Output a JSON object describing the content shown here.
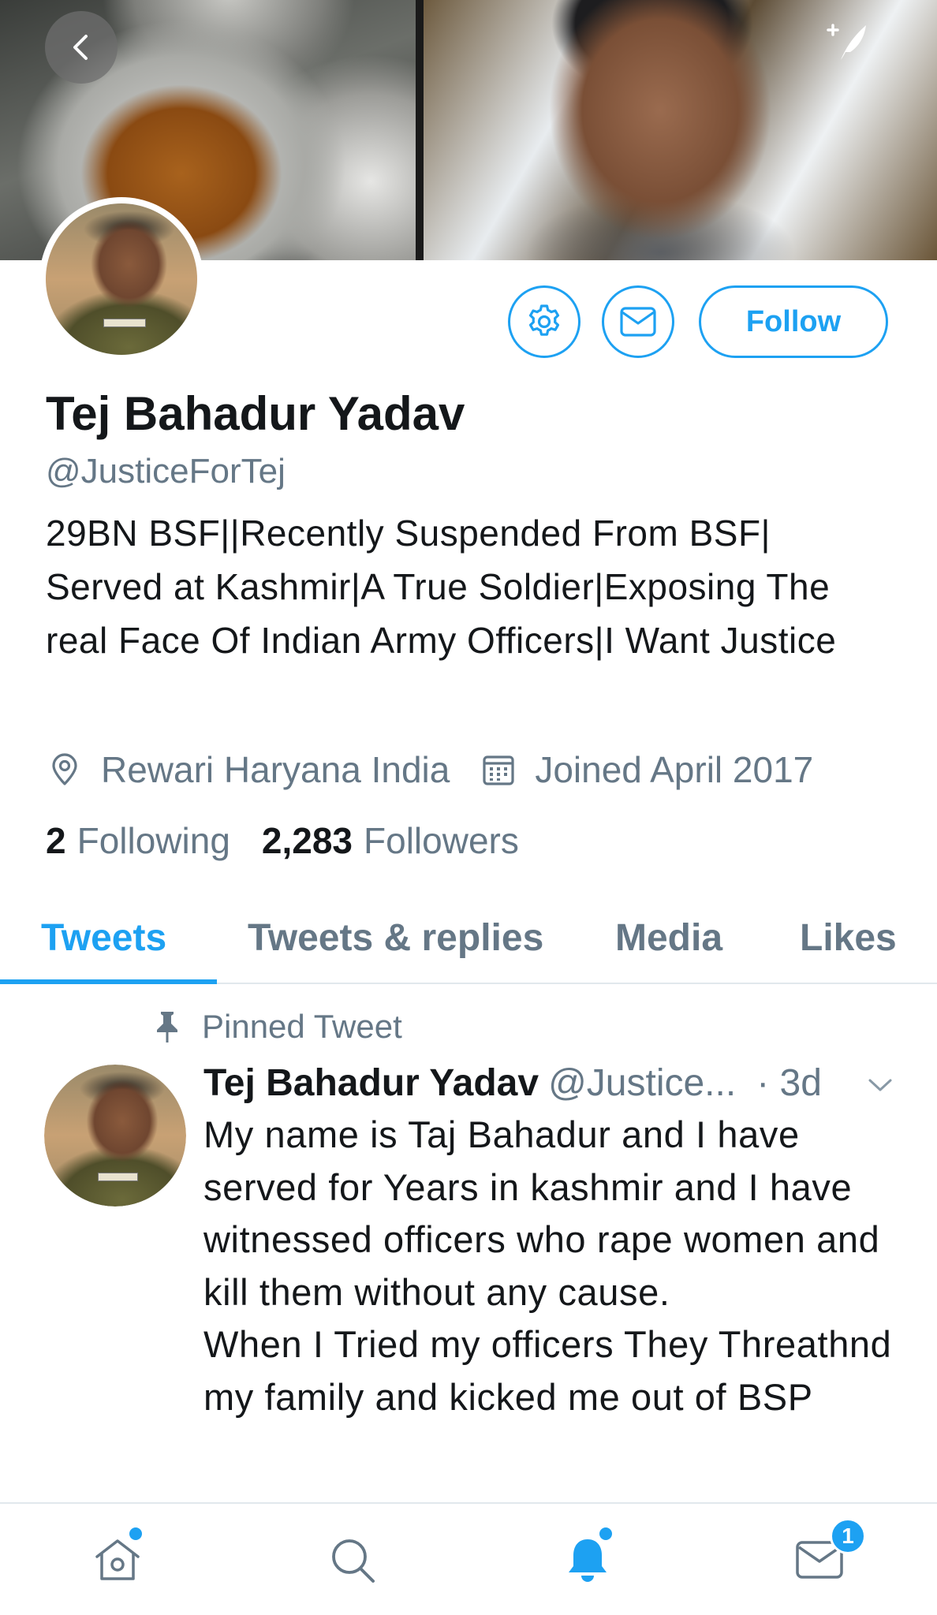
{
  "header": {
    "back_icon": "chevron-left-icon",
    "compose_icon": "compose-tweet-icon"
  },
  "profile": {
    "name": "Tej Bahadur Yadav",
    "handle": "@JusticeForTej",
    "bio": "29BN BSF||Recently Suspended From BSF| Served at Kashmir|A True Soldier|Exposing The real Face Of Indian Army Officers|I Want Justice",
    "location": "Rewari Haryana India",
    "joined": "Joined April 2017",
    "following_count": "2",
    "following_label": "Following",
    "followers_count": "2,283",
    "followers_label": "Followers",
    "avatar_tag_text": "TEJ BAHADUR YADAV"
  },
  "actions": {
    "settings_icon": "gear-icon",
    "message_icon": "envelope-icon",
    "follow_label": "Follow"
  },
  "tabs": [
    {
      "label": "Tweets",
      "active": true
    },
    {
      "label": "Tweets & replies",
      "active": false
    },
    {
      "label": "Media",
      "active": false
    },
    {
      "label": "Likes",
      "active": false
    }
  ],
  "pinned_tweet": {
    "pinned_label": "Pinned Tweet",
    "author_name": "Tej Bahadur Yadav",
    "author_handle": "@Justice...",
    "time": "· 3d",
    "text": "My name is Taj Bahadur and I have served for Years in kashmir and I have witnessed officers who rape women and kill them without any cause.\nWhen I Tried my officers They Threathnd my family and kicked me out of BSP"
  },
  "bottom_nav": {
    "items": [
      {
        "name": "home",
        "icon": "home-icon",
        "has_dot": true
      },
      {
        "name": "search",
        "icon": "search-icon",
        "has_dot": false
      },
      {
        "name": "notifications",
        "icon": "bell-icon",
        "has_dot": true
      },
      {
        "name": "messages",
        "icon": "envelope-icon",
        "has_dot": false
      }
    ],
    "messages_badge": "1"
  },
  "colors": {
    "accent": "#1da1f2",
    "text_primary": "#14171a",
    "text_secondary": "#657786",
    "divider": "#e1e8ed"
  }
}
